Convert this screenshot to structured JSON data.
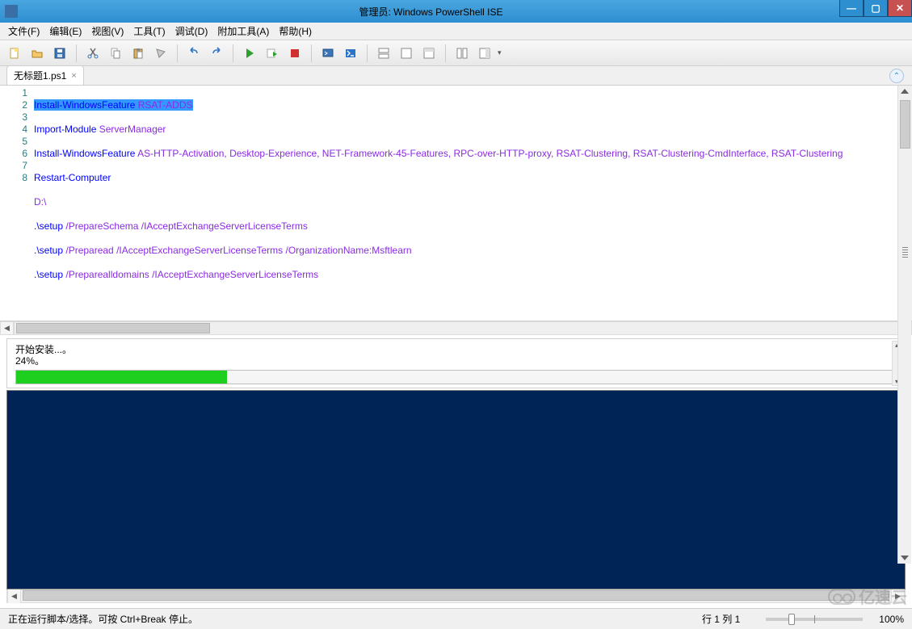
{
  "window": {
    "title": "管理员: Windows PowerShell ISE"
  },
  "menus": {
    "file": "文件(F)",
    "edit": "编辑(E)",
    "view": "视图(V)",
    "tools": "工具(T)",
    "debug": "调试(D)",
    "addons": "附加工具(A)",
    "help": "帮助(H)"
  },
  "tab": {
    "name": "无标题1.ps1",
    "close": "×"
  },
  "editor": {
    "lines": {
      "l1": {
        "num": "1",
        "cmd": "Install-WindowsFeature ",
        "arg": "RSAT-ADDS"
      },
      "l2": {
        "num": "2",
        "cmd": "Import-Module ",
        "arg": "ServerManager"
      },
      "l3": {
        "num": "3",
        "cmd": "Install-WindowsFeature ",
        "arg": "AS-HTTP-Activation, Desktop-Experience, NET-Framework-45-Features, RPC-over-HTTP-proxy, RSAT-Clustering, RSAT-Clustering-CmdInterface, RSAT-Clustering"
      },
      "l4": {
        "num": "4",
        "cmd": "Restart-Computer",
        "arg": ""
      },
      "l5": {
        "num": "5",
        "cmd": "",
        "arg": "D:\\"
      },
      "l6": {
        "num": "6",
        "cmd": ".\\setup ",
        "arg": "/PrepareSchema /IAcceptExchangeServerLicenseTerms"
      },
      "l7": {
        "num": "7",
        "cmd": ".\\setup ",
        "arg": "/Preparead /IAcceptExchangeServerLicenseTerms /OrganizationName:Msftlearn"
      },
      "l8": {
        "num": "8",
        "cmd": ".\\setup ",
        "arg": "/Preparealldomains /IAcceptExchangeServerLicenseTerms"
      }
    }
  },
  "progress": {
    "text1": "开始安装...。",
    "text2": "    24%。",
    "percent": 24
  },
  "status": {
    "left": "正在运行脚本/选择。可按 Ctrl+Break 停止。",
    "pos": "行 1 列 1",
    "zoom": "100%"
  },
  "watermark": "亿速云"
}
